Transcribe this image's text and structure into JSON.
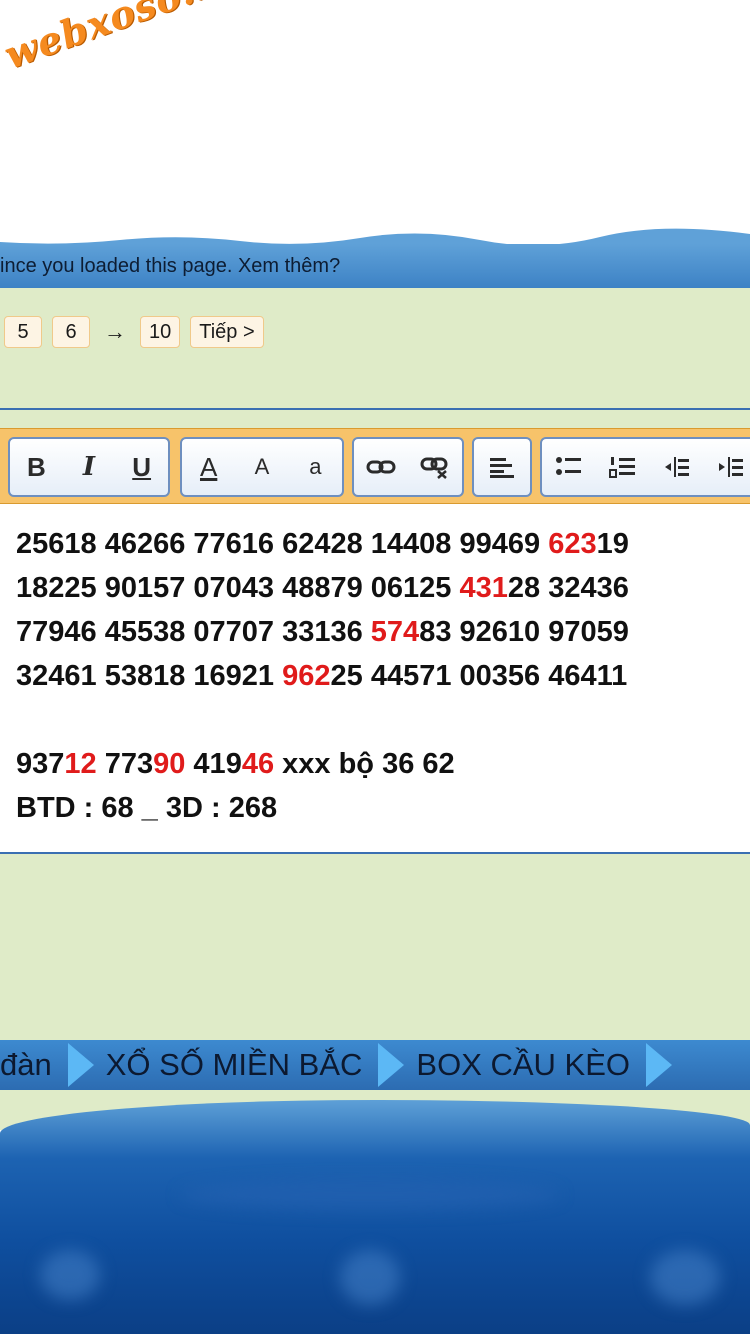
{
  "site": {
    "logo_text": "webxoso.net"
  },
  "notice": {
    "text": "ince you loaded this page. Xem thêm?"
  },
  "pagination": {
    "pages": [
      "5",
      "6"
    ],
    "arrow": "→",
    "last_page": "10",
    "next_label": "Tiếp >"
  },
  "toolbar": {
    "bold": "B",
    "italic": "I",
    "underline": "U",
    "font_color": "A",
    "font_size": "A",
    "font_style": "a"
  },
  "editor": {
    "lines": [
      [
        {
          "t": "25618 46266 77616 62428 14408 99469 "
        },
        {
          "t": "623",
          "red": true
        },
        {
          "t": "19"
        }
      ],
      [
        {
          "t": "18225 90157 07043 48879 06125 "
        },
        {
          "t": "431",
          "red": true
        },
        {
          "t": "28 32436"
        }
      ],
      [
        {
          "t": "77946 45538 07707 33136 "
        },
        {
          "t": "574",
          "red": true
        },
        {
          "t": "83 92610 97059"
        }
      ],
      [
        {
          "t": "32461 53818 16921 "
        },
        {
          "t": "962",
          "red": true
        },
        {
          "t": "25 44571 00356 46411"
        }
      ],
      [],
      [
        {
          "t": "937"
        },
        {
          "t": "12",
          "red": true
        },
        {
          "t": " 773"
        },
        {
          "t": "90",
          "red": true
        },
        {
          "t": " 419"
        },
        {
          "t": "46",
          "red": true
        },
        {
          "t": " xxx bộ 36 62"
        }
      ],
      [
        {
          "t": "BTD : 68 _ 3D : 268"
        }
      ]
    ]
  },
  "nav": {
    "items": [
      "đàn",
      "XỔ SỐ MIỀN BẮC",
      "BOX CẦU KÈO"
    ]
  },
  "colors": {
    "highlight": "#e01b1b",
    "accent": "#3d82c5",
    "panel": "#dfebc8"
  }
}
